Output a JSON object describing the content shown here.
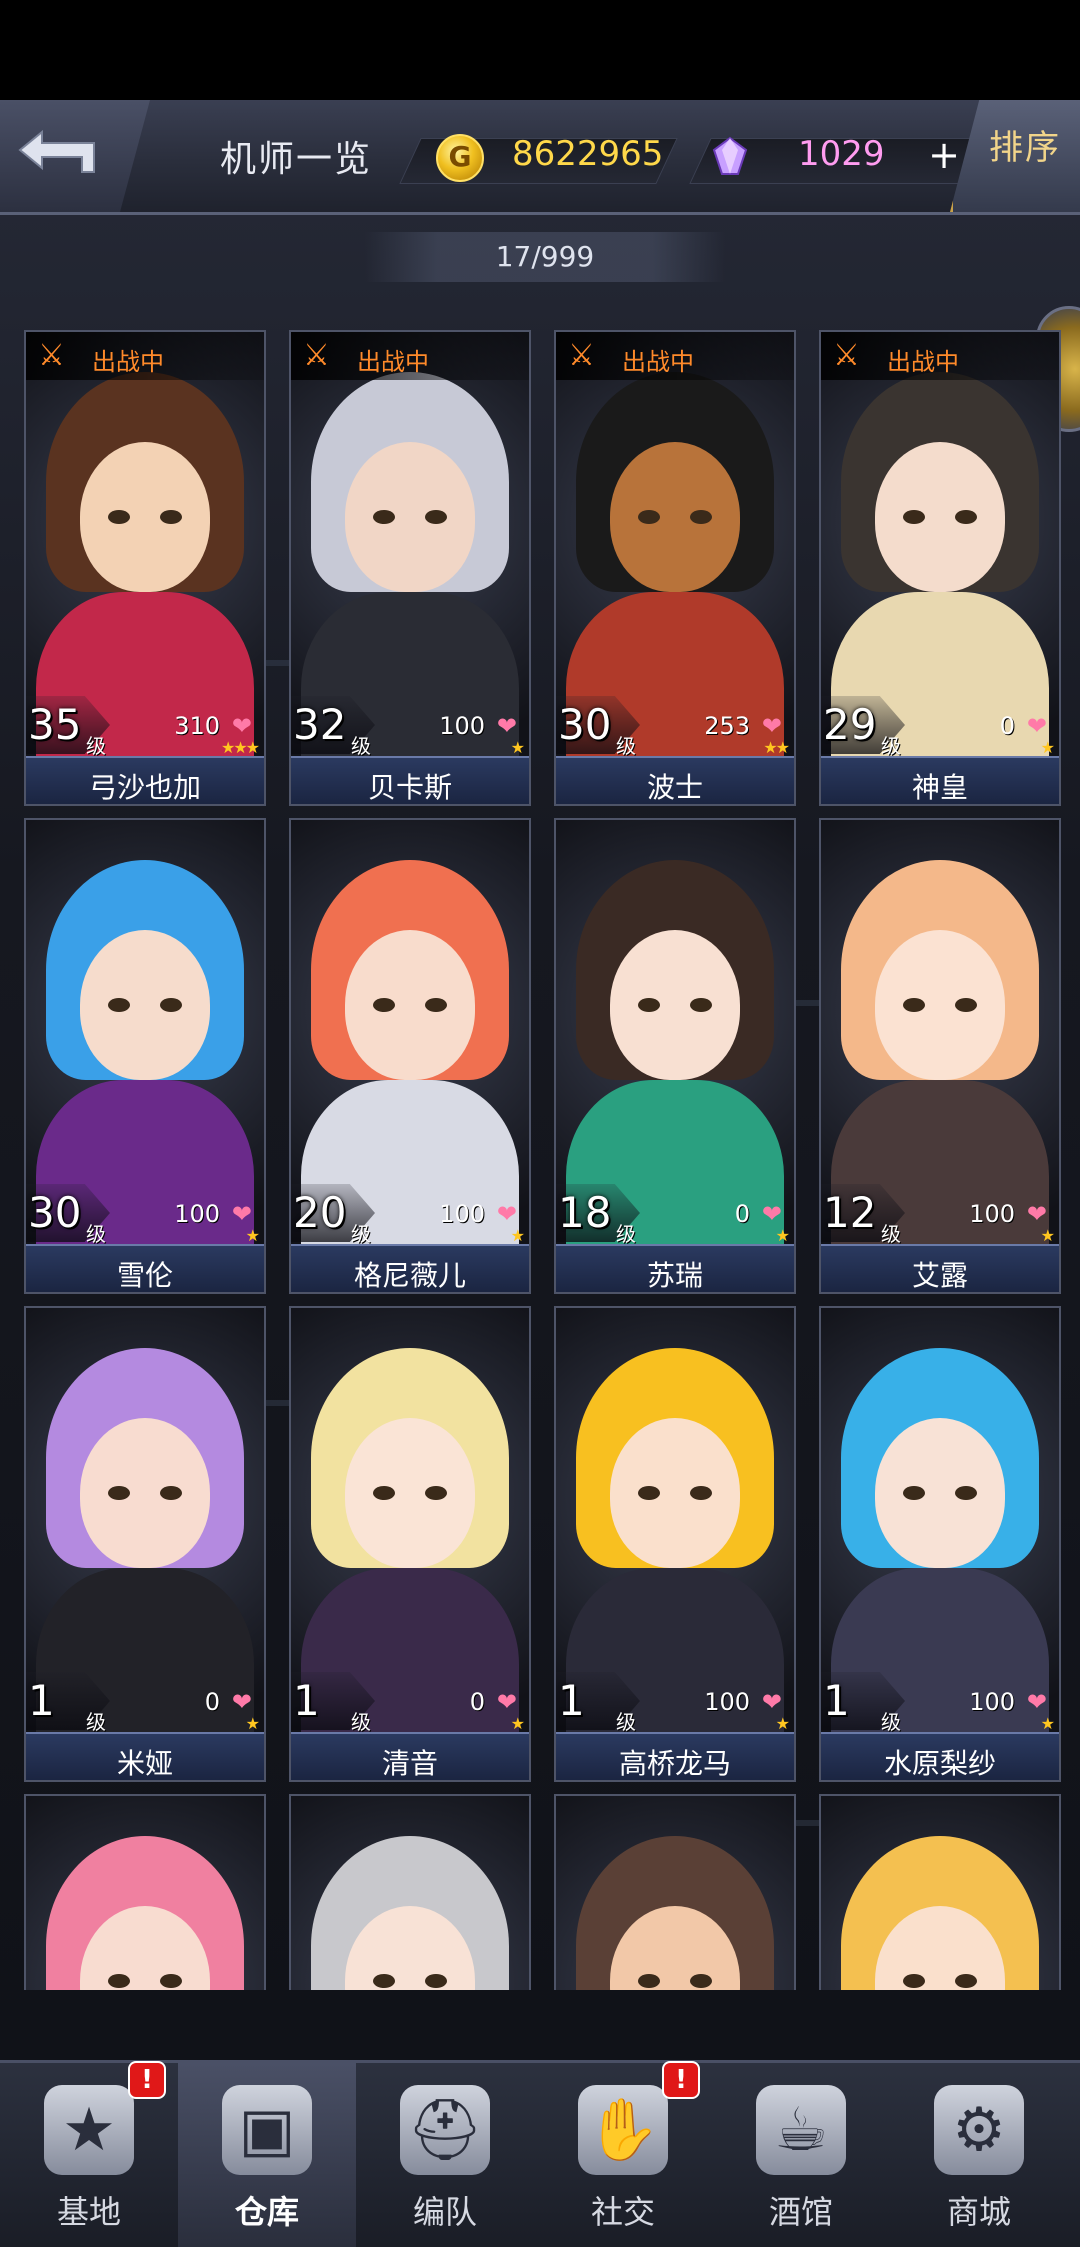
{
  "header": {
    "title": "机师一览",
    "gold_icon": "gold-coin-icon",
    "gold_symbol": "G",
    "gold": "8622965",
    "gem_icon": "crystal-icon",
    "gems": "1029",
    "plus": "+",
    "sort_label": "排序"
  },
  "count": "17/999",
  "level_suffix": "级",
  "deploy_label": "出战中",
  "deploy_icon": "⚔",
  "heart_icon": "❤",
  "pilots": [
    {
      "name": "弓沙也加",
      "level": "35",
      "trust": "310",
      "stars": "★★★",
      "deployed": true,
      "hair": "#5a3320",
      "skin": "#f3d2b4",
      "body": "#c2284a"
    },
    {
      "name": "贝卡斯",
      "level": "32",
      "trust": "100",
      "stars": "★",
      "deployed": true,
      "hair": "#c7c9d6",
      "skin": "#f1d6c6",
      "body": "#2a2c34"
    },
    {
      "name": "波士",
      "level": "30",
      "trust": "253",
      "stars": "★★",
      "deployed": true,
      "hair": "#1a1a1a",
      "skin": "#b8733a",
      "body": "#b03a2a"
    },
    {
      "name": "神皇",
      "level": "29",
      "trust": "0",
      "stars": "★",
      "deployed": true,
      "hair": "#3a3430",
      "skin": "#f4dccc",
      "body": "#e8d8b0"
    },
    {
      "name": "雪伦",
      "level": "30",
      "trust": "100",
      "stars": "★",
      "deployed": false,
      "hair": "#3aa0e8",
      "skin": "#f6dccc",
      "body": "#6a2a8a"
    },
    {
      "name": "格尼薇儿",
      "level": "20",
      "trust": "100",
      "stars": "★",
      "deployed": false,
      "hair": "#f07050",
      "skin": "#f8dccc",
      "body": "#d8dae4"
    },
    {
      "name": "苏瑞",
      "level": "18",
      "trust": "0",
      "stars": "★",
      "deployed": false,
      "hair": "#3a2a24",
      "skin": "#f8e0d2",
      "body": "#2aa080"
    },
    {
      "name": "艾露",
      "level": "12",
      "trust": "100",
      "stars": "★",
      "deployed": false,
      "hair": "#f4b88a",
      "skin": "#fbe2d2",
      "body": "#4a3a3a"
    },
    {
      "name": "米娅",
      "level": "1",
      "trust": "0",
      "stars": "★",
      "deployed": false,
      "hair": "#b48ae0",
      "skin": "#f8dcd0",
      "body": "#222228"
    },
    {
      "name": "清音",
      "level": "1",
      "trust": "0",
      "stars": "★",
      "deployed": false,
      "hair": "#f2e2a0",
      "skin": "#fae4d6",
      "body": "#3a2a4a"
    },
    {
      "name": "高桥龙马",
      "level": "1",
      "trust": "100",
      "stars": "★",
      "deployed": false,
      "hair": "#f8c020",
      "skin": "#fae0cc",
      "body": "#2a2a38"
    },
    {
      "name": "水原梨纱",
      "level": "1",
      "trust": "100",
      "stars": "★",
      "deployed": false,
      "hair": "#38b0e8",
      "skin": "#f8e2d6",
      "body": "#3a3a52"
    },
    {
      "name": "",
      "level": "",
      "trust": "",
      "stars": "",
      "deployed": false,
      "hair": "#f080a0",
      "skin": "#f8dcd0",
      "body": "#f080a0"
    },
    {
      "name": "",
      "level": "",
      "trust": "",
      "stars": "",
      "deployed": false,
      "hair": "#c8c8cc",
      "skin": "#f8e2d6",
      "body": "#c8c8cc"
    },
    {
      "name": "",
      "level": "",
      "trust": "",
      "stars": "",
      "deployed": false,
      "hair": "#5a4036",
      "skin": "#f2c8a8",
      "body": "#5a4036"
    },
    {
      "name": "",
      "level": "",
      "trust": "",
      "stars": "",
      "deployed": false,
      "hair": "#f4c050",
      "skin": "#fae0cc",
      "body": "#f4c050"
    }
  ],
  "nav": [
    {
      "label": "基地",
      "icon": "base-star-icon",
      "glyph": "★",
      "badge": "!",
      "active": false
    },
    {
      "label": "仓库",
      "icon": "warehouse-box-icon",
      "glyph": "▣",
      "badge": "",
      "active": true
    },
    {
      "label": "编队",
      "icon": "mech-helmet-icon",
      "glyph": "⛑",
      "badge": "",
      "active": false
    },
    {
      "label": "社交",
      "icon": "handshake-icon",
      "glyph": "✋",
      "badge": "!",
      "active": false
    },
    {
      "label": "酒馆",
      "icon": "beer-mug-icon",
      "glyph": "☕",
      "badge": "",
      "active": false
    },
    {
      "label": "商城",
      "icon": "shop-gear-icon",
      "glyph": "⚙",
      "badge": "",
      "active": false
    }
  ]
}
